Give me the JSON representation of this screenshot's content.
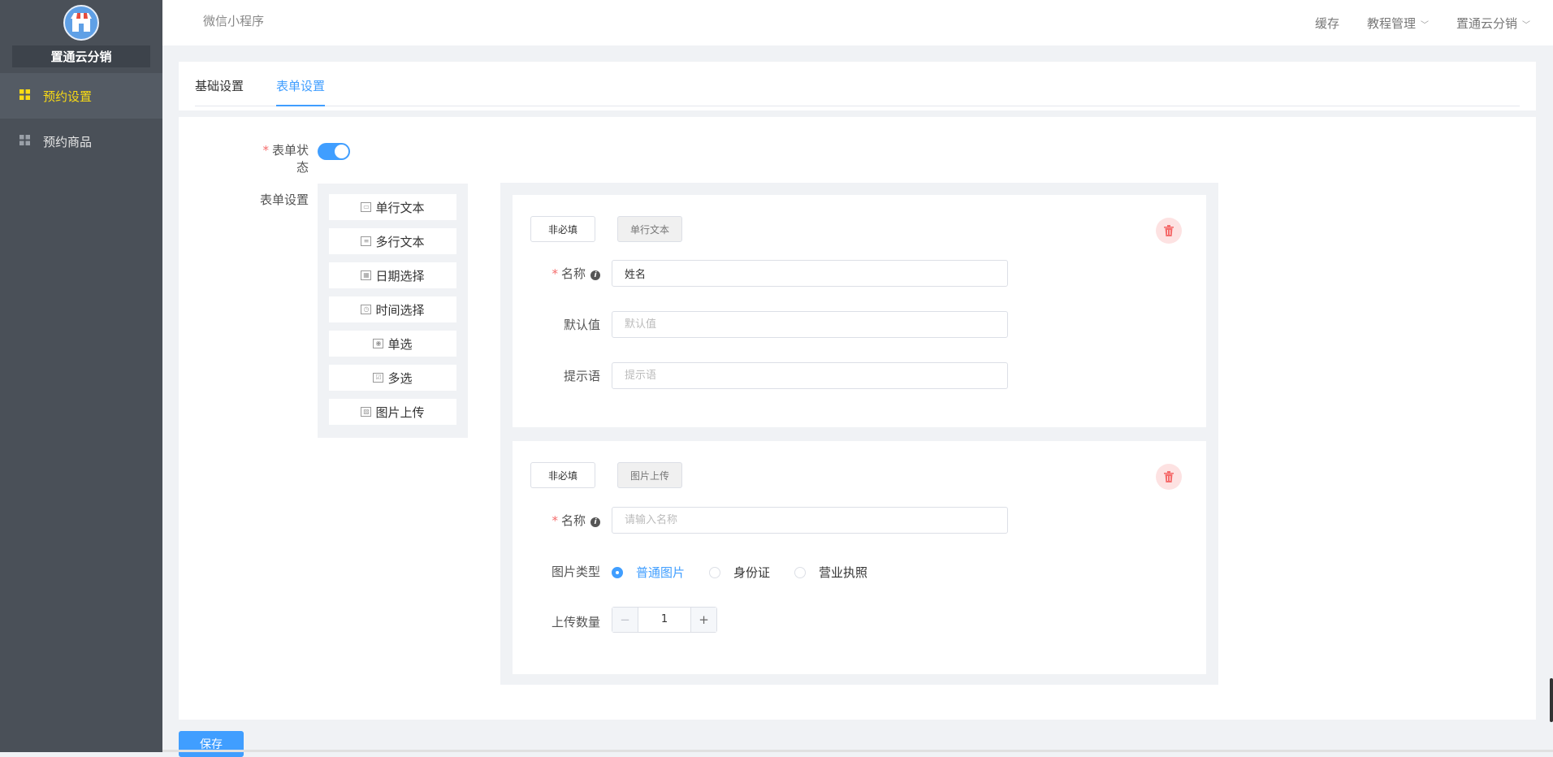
{
  "app": {
    "brand": "置通云分销",
    "header_title": "微信小程序",
    "header_links": {
      "cache": "缓存",
      "tutorial": "教程管理",
      "account": "置通云分销"
    }
  },
  "sidebar": {
    "items": [
      {
        "label": "预约设置",
        "active": true
      },
      {
        "label": "预约商品",
        "active": false
      }
    ]
  },
  "tabs": [
    {
      "label": "基础设置",
      "active": false
    },
    {
      "label": "表单设置",
      "active": true
    }
  ],
  "form": {
    "status_label": "表单状态",
    "status_on": true,
    "settings_label": "表单设置",
    "palette": [
      "单行文本",
      "多行文本",
      "日期选择",
      "时间选择",
      "单选",
      "多选",
      "图片上传"
    ],
    "fields": [
      {
        "required_button": "非必填",
        "type_tag": "单行文本",
        "name_label": "名称",
        "name_value": "姓名",
        "default_label": "默认值",
        "default_placeholder": "默认值",
        "hint_label": "提示语",
        "hint_placeholder": "提示语"
      },
      {
        "required_button": "非必填",
        "type_tag": "图片上传",
        "name_label": "名称",
        "name_placeholder": "请输入名称",
        "image_type_label": "图片类型",
        "image_types": [
          {
            "label": "普通图片",
            "checked": true
          },
          {
            "label": "身份证",
            "checked": false
          },
          {
            "label": "营业执照",
            "checked": false
          }
        ],
        "count_label": "上传数量",
        "count_value": "1"
      }
    ]
  },
  "actions": {
    "save_label": "保存"
  },
  "colors": {
    "primary": "#409eff",
    "danger": "#f56c6c",
    "sidebar_bg": "#4a5058",
    "active_menu_text": "#fadb14"
  }
}
